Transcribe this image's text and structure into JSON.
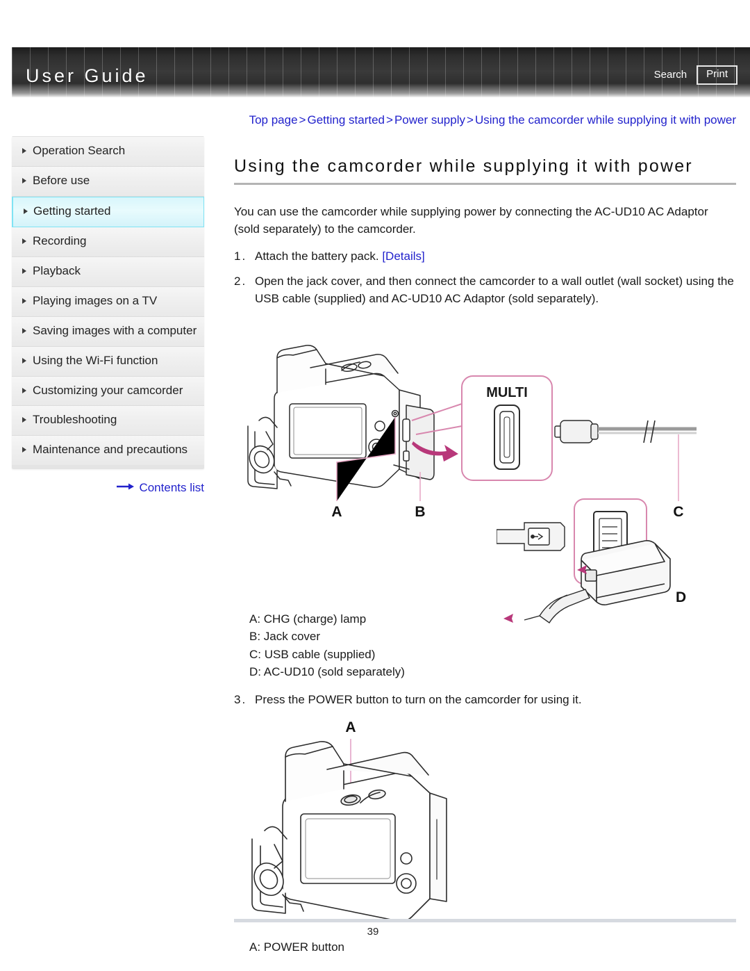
{
  "header": {
    "title": "User Guide",
    "search_label": "Search",
    "print_label": "Print"
  },
  "sidebar": {
    "items": [
      {
        "label": "Operation Search",
        "active": false
      },
      {
        "label": "Before use",
        "active": false
      },
      {
        "label": "Getting started",
        "active": true
      },
      {
        "label": "Recording",
        "active": false
      },
      {
        "label": "Playback",
        "active": false
      },
      {
        "label": "Playing images on a TV",
        "active": false
      },
      {
        "label": "Saving images with a computer",
        "active": false
      },
      {
        "label": "Using the Wi-Fi function",
        "active": false
      },
      {
        "label": "Customizing your camcorder",
        "active": false
      },
      {
        "label": "Troubleshooting",
        "active": false
      },
      {
        "label": "Maintenance and precautions",
        "active": false
      }
    ],
    "contents_list_label": "Contents list"
  },
  "breadcrumb": {
    "items": [
      "Top page",
      "Getting started",
      "Power supply",
      "Using the camcorder while supplying it with power"
    ],
    "separator": ">"
  },
  "main": {
    "title": "Using the camcorder while supplying it with power",
    "intro": "You can use the camcorder while supplying power by connecting the AC-UD10 AC Adaptor (sold separately) to the camcorder.",
    "steps": [
      {
        "number": "1.",
        "text_before": "Attach the battery pack. ",
        "link": "[Details]",
        "text_after": ""
      },
      {
        "number": "2.",
        "text_before": "Open the jack cover, and then connect the camcorder to a wall outlet (wall socket) using the USB cable (supplied) and AC-UD10 AC Adaptor (sold separately).",
        "link": "",
        "text_after": ""
      },
      {
        "number": "3.",
        "text_before": "Press the POWER button to turn on the camcorder for using it.",
        "link": "",
        "text_after": ""
      }
    ],
    "figure1": {
      "callout_label": "MULTI",
      "markers": [
        "A",
        "B",
        "C",
        "D"
      ]
    },
    "legend1": [
      "A: CHG (charge) lamp",
      "B: Jack cover",
      "C: USB cable (supplied)",
      "D: AC-UD10 (sold separately)"
    ],
    "figure2": {
      "markers": [
        "A"
      ]
    },
    "legend2": [
      "A: POWER button"
    ]
  },
  "footer": {
    "page_number": "39"
  },
  "colors": {
    "link": "#2222cc",
    "callout_pink": "#d16f9e",
    "active_nav": "#d8f6fb",
    "banner_dark": "#2e2e2e"
  }
}
